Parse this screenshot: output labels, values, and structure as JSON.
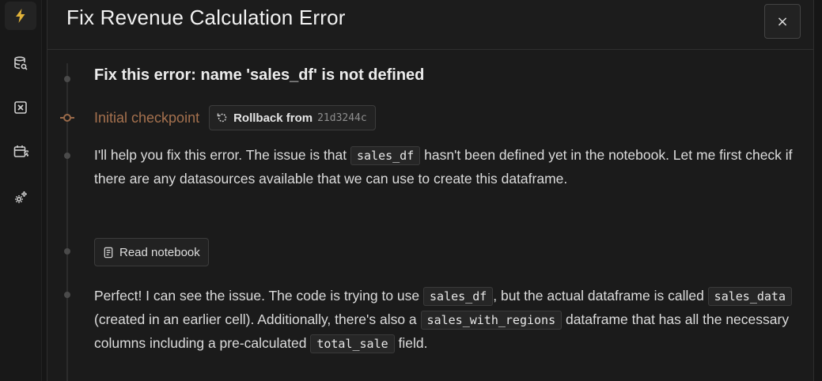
{
  "rail": {
    "items": [
      {
        "icon": "lightning-icon",
        "active": true
      },
      {
        "icon": "database-search-icon"
      },
      {
        "icon": "variable-x-icon"
      },
      {
        "icon": "calendar-refresh-icon"
      },
      {
        "icon": "settings-gear-icon"
      }
    ]
  },
  "dialog": {
    "title": "Fix Revenue Calculation Error",
    "close_label": "×"
  },
  "thread": {
    "user_message": "Fix this error: name 'sales_df' is not defined",
    "checkpoint": {
      "label": "Initial checkpoint",
      "rollback_label": "Rollback from",
      "hash": "21d3244c"
    },
    "msg1": {
      "t1": "I'll help you fix this error. The issue is that ",
      "c1": "sales_df",
      "t2": " hasn't been defined yet in the notebook. Let me first check if there are any datasources available that we can use to create this dataframe."
    },
    "tool_call_label": "Read notebook",
    "msg2": {
      "t1": "Perfect! I can see the issue. The code is trying to use ",
      "c1": "sales_df",
      "t2": ", but the actual dataframe is called ",
      "c2": "sales_data",
      "t3": " (created in an earlier cell). Additionally, there's also a ",
      "c3": "sales_with_regions",
      "t4": " dataframe that has all the necessary columns including a pre-calculated ",
      "c4": "total_sale",
      "t5": " field."
    }
  },
  "colors": {
    "accent_lightning": "#e0b23a",
    "checkpoint": "#a5714e"
  }
}
